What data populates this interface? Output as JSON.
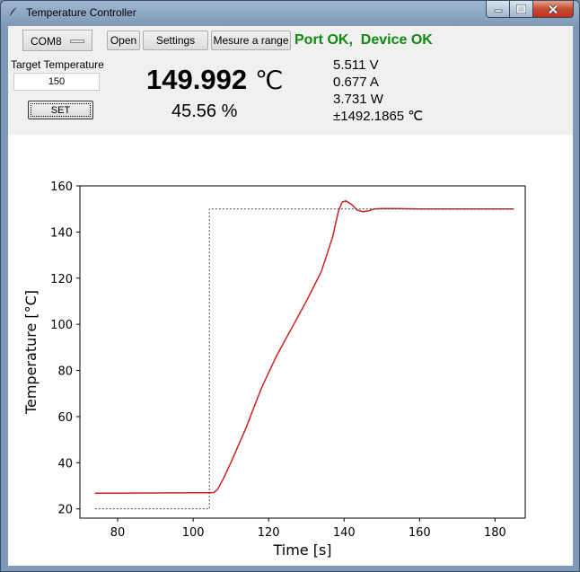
{
  "window": {
    "title": "Temperature Controller"
  },
  "toolbar": {
    "port_value": "COM8",
    "open_label": "Open",
    "settings_label": "Settings",
    "range_label": "Mesure a range",
    "port_status": "Port OK,",
    "device_status": "Device OK",
    "status_color": "#0f8a0f"
  },
  "target": {
    "label": "Target Temperature",
    "value": "150",
    "set_label": "SET"
  },
  "readout": {
    "temperature": "149.992",
    "unit": "℃",
    "percent": "45.56 %",
    "voltage": "5.511 V",
    "current": "0.677 A",
    "power": "3.731 W",
    "deviation": "±1492.1865 ℃"
  },
  "chart_data": {
    "type": "line",
    "xlabel": "Time [s]",
    "ylabel": "Temperature [°C]",
    "xlim": [
      70,
      188
    ],
    "ylim": [
      16,
      160
    ],
    "x_ticks": [
      80,
      100,
      120,
      140,
      160,
      180
    ],
    "y_ticks": [
      20,
      40,
      60,
      80,
      100,
      120,
      140,
      160
    ],
    "grid": false,
    "series": [
      {
        "style": "red-solid",
        "color": "#cc2222",
        "points": [
          [
            74,
            26.8
          ],
          [
            90,
            26.9
          ],
          [
            100,
            27.0
          ],
          [
            104,
            27.0
          ],
          [
            105.5,
            27.1
          ],
          [
            106.5,
            28.5
          ],
          [
            108,
            33
          ],
          [
            110,
            40
          ],
          [
            114,
            55
          ],
          [
            118,
            72
          ],
          [
            122,
            86
          ],
          [
            126,
            98
          ],
          [
            130,
            110
          ],
          [
            134,
            123
          ],
          [
            137,
            138
          ],
          [
            138.5,
            149
          ],
          [
            139.5,
            153
          ],
          [
            140.5,
            153.5
          ],
          [
            142,
            152
          ],
          [
            143.5,
            149.5
          ],
          [
            145,
            148.8
          ],
          [
            146.5,
            149.2
          ],
          [
            148,
            150
          ],
          [
            150,
            150.2
          ],
          [
            155,
            150.1
          ],
          [
            160,
            150
          ],
          [
            170,
            150
          ],
          [
            185,
            150
          ]
        ]
      },
      {
        "style": "black-dashed",
        "color": "#333333",
        "points": [
          [
            74,
            20
          ],
          [
            104.3,
            20
          ],
          [
            104.3,
            150
          ],
          [
            185,
            150
          ]
        ]
      }
    ]
  }
}
